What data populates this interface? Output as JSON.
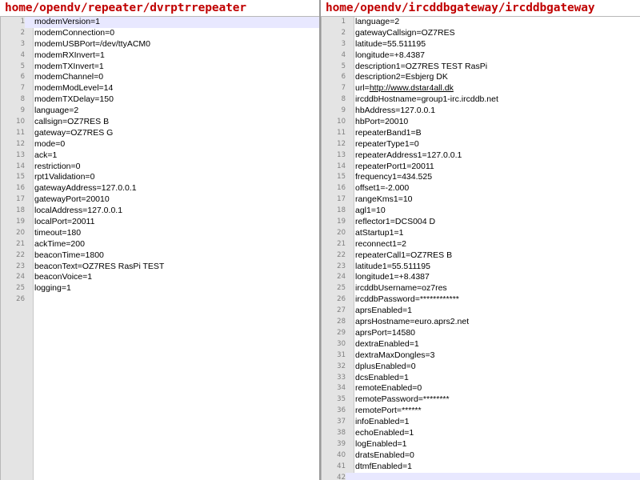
{
  "left_pane": {
    "title": "home/opendv/repeater/dvrptrrepeater",
    "current_line": 1,
    "lines": [
      {
        "num": "1",
        "text": "modemVersion=1"
      },
      {
        "num": "2",
        "text": "modemConnection=0"
      },
      {
        "num": "3",
        "text": "modemUSBPort=/dev/ttyACM0"
      },
      {
        "num": "4",
        "text": "modemRXInvert=1"
      },
      {
        "num": "5",
        "text": "modemTXInvert=1"
      },
      {
        "num": "6",
        "text": "modemChannel=0"
      },
      {
        "num": "7",
        "text": "modemModLevel=14"
      },
      {
        "num": "8",
        "text": "modemTXDelay=150"
      },
      {
        "num": "9",
        "text": "language=2"
      },
      {
        "num": "10",
        "text": "callsign=OZ7RES B"
      },
      {
        "num": "11",
        "text": "gateway=OZ7RES G"
      },
      {
        "num": "12",
        "text": "mode=0"
      },
      {
        "num": "13",
        "text": "ack=1"
      },
      {
        "num": "14",
        "text": "restriction=0"
      },
      {
        "num": "15",
        "text": "rpt1Validation=0"
      },
      {
        "num": "16",
        "text": "gatewayAddress=127.0.0.1"
      },
      {
        "num": "17",
        "text": "gatewayPort=20010"
      },
      {
        "num": "18",
        "text": "localAddress=127.0.0.1"
      },
      {
        "num": "19",
        "text": "localPort=20011"
      },
      {
        "num": "20",
        "text": "timeout=180"
      },
      {
        "num": "21",
        "text": "ackTime=200"
      },
      {
        "num": "22",
        "text": "beaconTime=1800"
      },
      {
        "num": "23",
        "text": "beaconText=OZ7RES RasPi TEST"
      },
      {
        "num": "24",
        "text": "beaconVoice=1"
      },
      {
        "num": "25",
        "text": "logging=1"
      },
      {
        "num": "26",
        "text": ""
      }
    ]
  },
  "right_pane": {
    "title": "home/opendv/ircddbgateway/ircddbgateway",
    "current_line": 42,
    "lines": [
      {
        "num": "1",
        "text": "language=2"
      },
      {
        "num": "2",
        "text": "gatewayCallsign=OZ7RES"
      },
      {
        "num": "3",
        "text": "latitude=55.511195"
      },
      {
        "num": "4",
        "text": "longitude=+8.4387"
      },
      {
        "num": "5",
        "text": "description1=OZ7RES TEST RasPi"
      },
      {
        "num": "6",
        "text": "description2=Esbjerg DK"
      },
      {
        "num": "7",
        "text": "url=",
        "link": "http://www.dstar4all.dk"
      },
      {
        "num": "8",
        "text": "ircddbHostname=group1-irc.ircddb.net"
      },
      {
        "num": "9",
        "text": "hbAddress=127.0.0.1"
      },
      {
        "num": "10",
        "text": "hbPort=20010"
      },
      {
        "num": "11",
        "text": "repeaterBand1=B"
      },
      {
        "num": "12",
        "text": "repeaterType1=0"
      },
      {
        "num": "13",
        "text": "repeaterAddress1=127.0.0.1"
      },
      {
        "num": "14",
        "text": "repeaterPort1=20011"
      },
      {
        "num": "15",
        "text": "frequency1=434.525"
      },
      {
        "num": "16",
        "text": "offset1=-2.000"
      },
      {
        "num": "17",
        "text": "rangeKms1=10"
      },
      {
        "num": "18",
        "text": "agl1=10"
      },
      {
        "num": "19",
        "text": "reflector1=DCS004 D"
      },
      {
        "num": "20",
        "text": "atStartup1=1"
      },
      {
        "num": "21",
        "text": "reconnect1=2"
      },
      {
        "num": "22",
        "text": "repeaterCall1=OZ7RES B"
      },
      {
        "num": "23",
        "text": "latitude1=55.511195"
      },
      {
        "num": "24",
        "text": "longitude1=+8.4387"
      },
      {
        "num": "25",
        "text": "ircddbUsername=oz7res"
      },
      {
        "num": "26",
        "text": "ircddbPassword=************"
      },
      {
        "num": "27",
        "text": "aprsEnabled=1"
      },
      {
        "num": "28",
        "text": "aprsHostname=euro.aprs2.net"
      },
      {
        "num": "29",
        "text": "aprsPort=14580"
      },
      {
        "num": "30",
        "text": "dextraEnabled=1"
      },
      {
        "num": "31",
        "text": "dextraMaxDongles=3"
      },
      {
        "num": "32",
        "text": "dplusEnabled=0"
      },
      {
        "num": "33",
        "text": "dcsEnabled=1"
      },
      {
        "num": "34",
        "text": "remoteEnabled=0"
      },
      {
        "num": "35",
        "text": "remotePassword=********"
      },
      {
        "num": "36",
        "text": "remotePort=******"
      },
      {
        "num": "37",
        "text": "infoEnabled=1"
      },
      {
        "num": "38",
        "text": "echoEnabled=1"
      },
      {
        "num": "39",
        "text": "logEnabled=1"
      },
      {
        "num": "40",
        "text": "dratsEnabled=0"
      },
      {
        "num": "41",
        "text": "dtmfEnabled=1"
      },
      {
        "num": "42",
        "text": ""
      }
    ]
  },
  "colors": {
    "title": "#c00000",
    "gutter_bg": "#e4e4e4",
    "current_line_bg": "#e8e8ff",
    "line_number": "#808080"
  }
}
